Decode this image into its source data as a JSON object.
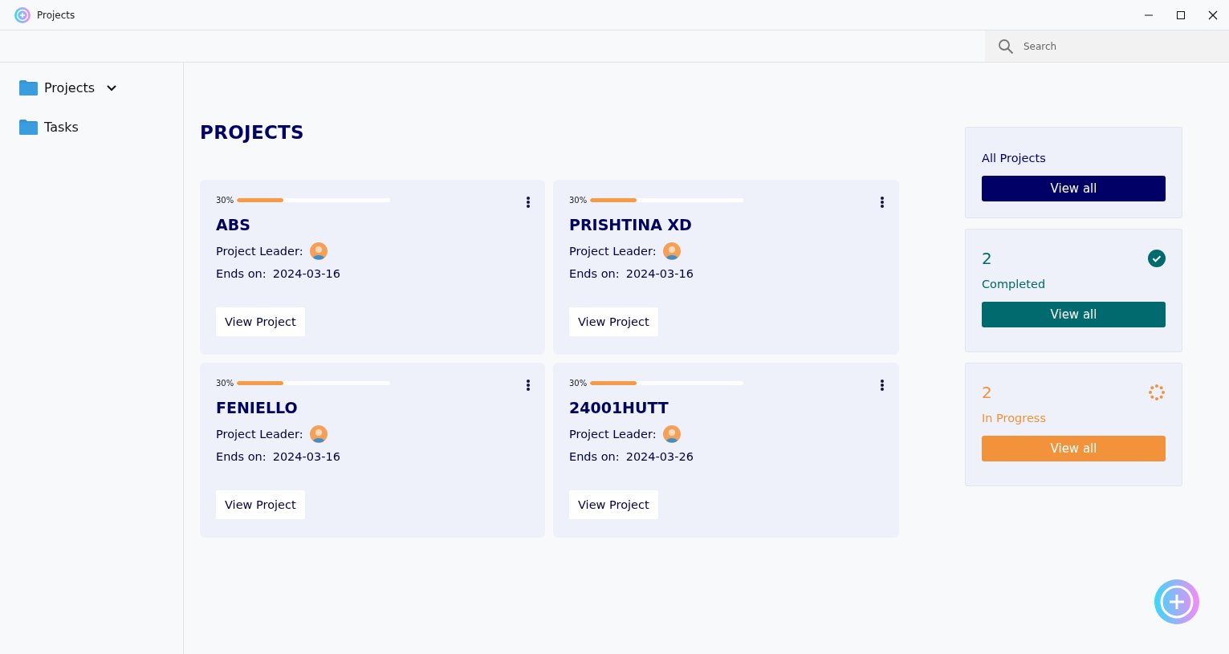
{
  "window": {
    "title": "Projects"
  },
  "search": {
    "placeholder": "Search"
  },
  "sidebar": {
    "items": [
      {
        "label": "Projects",
        "kind": "group"
      },
      {
        "label": "Tasks",
        "kind": "link"
      }
    ]
  },
  "page_title": "PROJECTS",
  "projects": [
    {
      "progress": "30%",
      "level": 0.3,
      "name": "ABS",
      "leader_label": "Project Leader:",
      "ends_label": "Ends on:",
      "ends": "2024-03-16",
      "button": "View Project"
    },
    {
      "progress": "30%",
      "level": 0.3,
      "name": "PRISHTINA XD",
      "leader_label": "Project Leader:",
      "ends_label": "Ends on:",
      "ends": "2024-03-16",
      "button": "View Project"
    },
    {
      "progress": "30%",
      "level": 0.3,
      "name": "FENIELLO",
      "leader_label": "Project Leader:",
      "ends_label": "Ends on:",
      "ends": "2024-03-16",
      "button": "View Project"
    },
    {
      "progress": "30%",
      "level": 0.3,
      "name": "24001HUTT",
      "leader_label": "Project Leader:",
      "ends_label": "Ends on:",
      "ends": "2024-03-26",
      "button": "View Project"
    }
  ],
  "summary": [
    {
      "kind": "all",
      "label": "All Projects",
      "button": "View all",
      "color": "#000066"
    },
    {
      "kind": "completed",
      "count": "2",
      "label": "Completed",
      "button": "View all",
      "color": "#006a6e"
    },
    {
      "kind": "in_progress",
      "count": "2",
      "label": "In Progress",
      "button": "View all",
      "color": "#f2923a"
    }
  ]
}
